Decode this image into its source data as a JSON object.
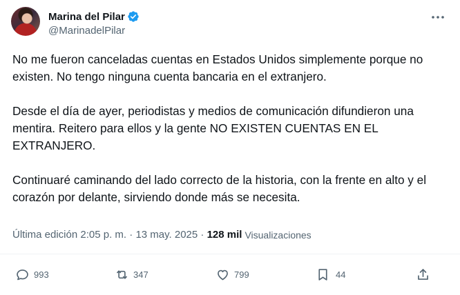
{
  "author": {
    "display_name": "Marina del Pilar",
    "handle": "@MarinadelPilar",
    "verified": true
  },
  "tweet": {
    "paragraphs": [
      "No me fueron canceladas cuentas en Estados Unidos simplemente porque no existen. No tengo ninguna cuenta bancaria en el extranjero.",
      "Desde el día de ayer, periodistas y medios de comunicación difundieron una mentira. Reitero para ellos y la gente NO EXISTEN CUENTAS EN EL EXTRANJERO.",
      "Continuaré caminando del lado correcto de la historia, con la frente en alto y el corazón por delante, sirviendo donde más se necesita."
    ],
    "edited_label": "Última edición",
    "time": "2:05 p. m.",
    "separator": " · ",
    "date": "13 may. 2025",
    "views_count": "128 mil",
    "views_label": "Visualizaciones"
  },
  "actions": {
    "replies": "993",
    "reposts": "347",
    "likes": "799",
    "bookmarks": "44"
  },
  "icons": {
    "verified": "verified-badge-icon",
    "more": "more-dots-icon",
    "reply": "reply-icon",
    "repost": "repost-icon",
    "like": "heart-icon",
    "bookmark": "bookmark-icon",
    "share": "share-icon"
  },
  "colors": {
    "verified_blue": "#1d9bf0",
    "text_primary": "#0f1419",
    "text_secondary": "#536471",
    "divider": "#eff3f4"
  }
}
